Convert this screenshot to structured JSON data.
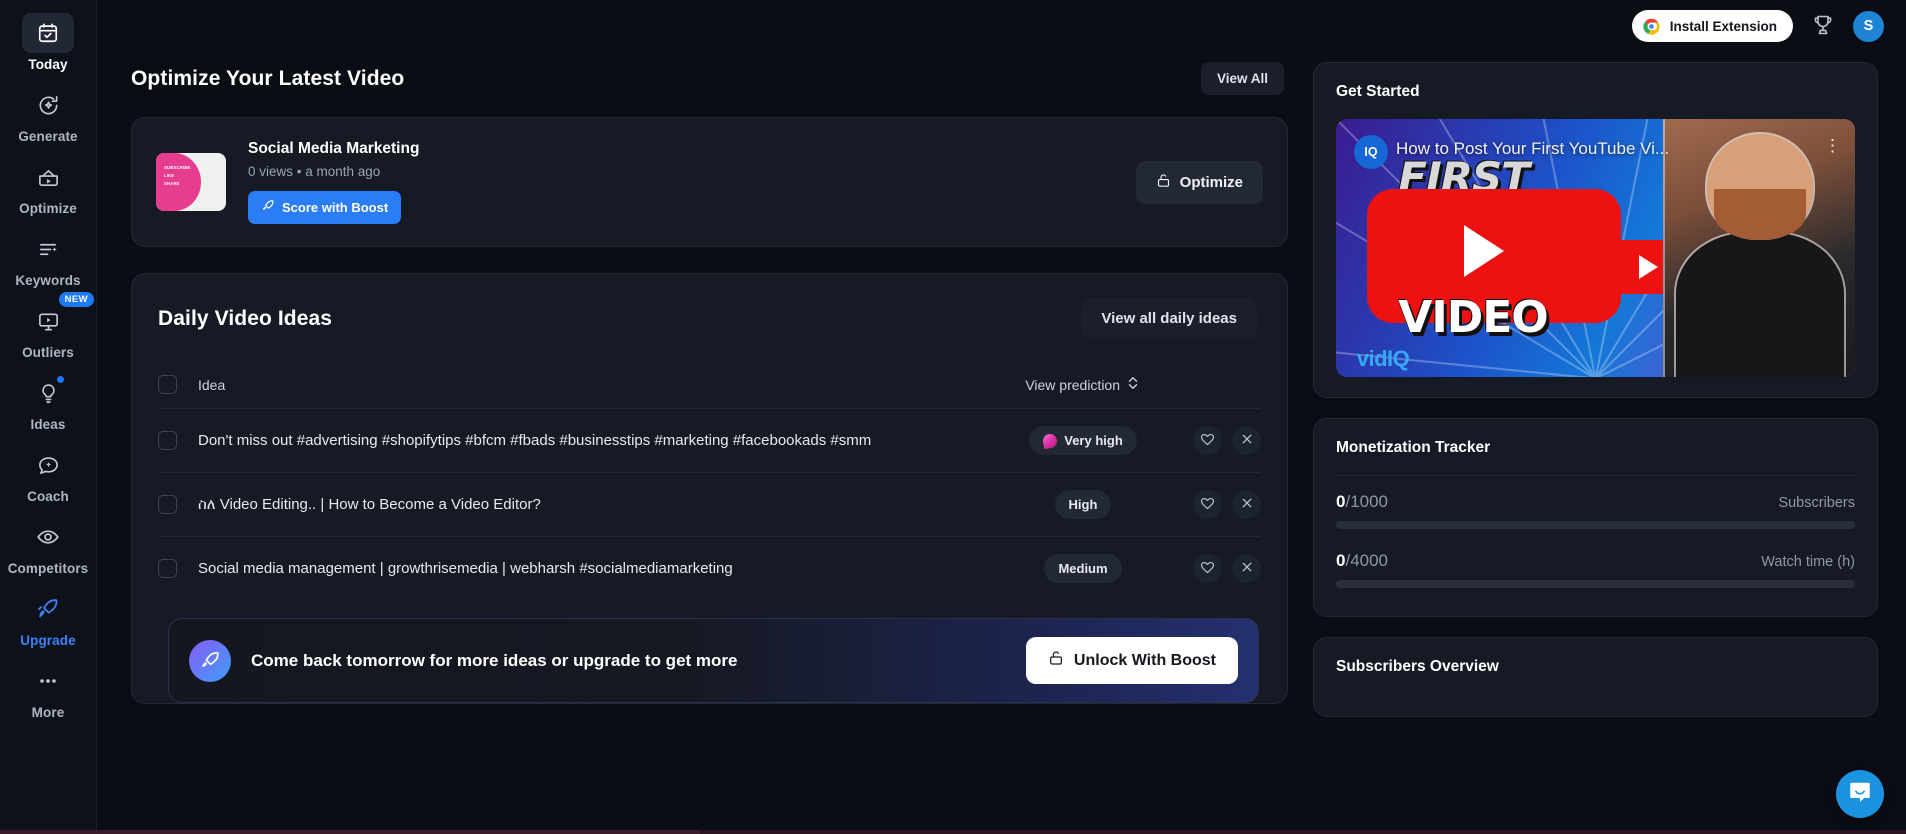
{
  "sidebar": {
    "items": [
      {
        "label": "Today",
        "icon": "calendar-check-icon",
        "active": true,
        "accent": false,
        "badge": null,
        "dot": false
      },
      {
        "label": "Generate",
        "icon": "sparkle-refresh-icon",
        "active": false,
        "accent": false,
        "badge": null,
        "dot": false
      },
      {
        "label": "Optimize",
        "icon": "video-optimize-icon",
        "active": false,
        "accent": false,
        "badge": null,
        "dot": false
      },
      {
        "label": "Keywords",
        "icon": "filter-sparkle-icon",
        "active": false,
        "accent": false,
        "badge": null,
        "dot": false
      },
      {
        "label": "Outliers",
        "icon": "monitor-play-icon",
        "active": false,
        "accent": false,
        "badge": "NEW",
        "dot": false
      },
      {
        "label": "Ideas",
        "icon": "lightbulb-icon",
        "active": false,
        "accent": false,
        "badge": null,
        "dot": true
      },
      {
        "label": "Coach",
        "icon": "chat-sparkle-icon",
        "active": false,
        "accent": false,
        "badge": null,
        "dot": false
      },
      {
        "label": "Competitors",
        "icon": "eye-icon",
        "active": false,
        "accent": false,
        "badge": null,
        "dot": false
      },
      {
        "label": "Upgrade",
        "icon": "rocket-icon",
        "active": false,
        "accent": true,
        "badge": null,
        "dot": false
      },
      {
        "label": "More",
        "icon": "ellipsis-icon",
        "active": false,
        "accent": false,
        "badge": null,
        "dot": false
      }
    ]
  },
  "header": {
    "install_label": "Install Extension",
    "avatar_initial": "S"
  },
  "optimize_section": {
    "title": "Optimize Your Latest Video",
    "view_all_label": "View All",
    "video": {
      "title": "Social Media Marketing",
      "meta": "0 views • a month ago",
      "boost_label": "Score with Boost",
      "optimize_label": "Optimize",
      "thumbnail_lines": [
        "SUBSCRIBE",
        "LIKE",
        "SHARE"
      ]
    }
  },
  "ideas_section": {
    "title": "Daily Video Ideas",
    "view_all_label": "View all daily ideas",
    "columns": {
      "idea": "Idea",
      "prediction": "View prediction"
    },
    "rows": [
      {
        "idea": "Don't miss out #advertising #shopifytips #bfcm #fbads #businesstips #marketing #facebookads #smm",
        "score": "Very high",
        "has_flame": true
      },
      {
        "idea": "ስለ Video Editing.. | How to Become a Video Editor?",
        "score": "High",
        "has_flame": false
      },
      {
        "idea": "Social media management | growthrisemedia | webharsh #socialmediamarketing",
        "score": "Medium",
        "has_flame": false
      }
    ],
    "promo": {
      "text": "Come back tomorrow for more ideas or upgrade to get more",
      "button": "Unlock With Boost"
    }
  },
  "right_panel": {
    "get_started": {
      "title": "Get Started",
      "video_title": "How to Post Your First YouTube Vi...",
      "channel_initials": "IQ",
      "brand_mark": "vid",
      "brand_mark_accent": "IQ",
      "thumb_word_top": "FIRST",
      "thumb_word_bottom": "VIDEO"
    },
    "monetization": {
      "title": "Monetization Tracker",
      "metrics": [
        {
          "current": "0",
          "target": "/1000",
          "label": "Subscribers",
          "percent": 0
        },
        {
          "current": "0",
          "target": "/4000",
          "label": "Watch time (h)",
          "percent": 0
        }
      ]
    },
    "subscribers_overview": {
      "title": "Subscribers Overview"
    }
  },
  "colors": {
    "background": "#0a0d14",
    "card": "#161a24",
    "accent_blue": "#2b7df5",
    "accent_pink": "#e73d8f",
    "intercom_blue": "#1b93e0"
  }
}
